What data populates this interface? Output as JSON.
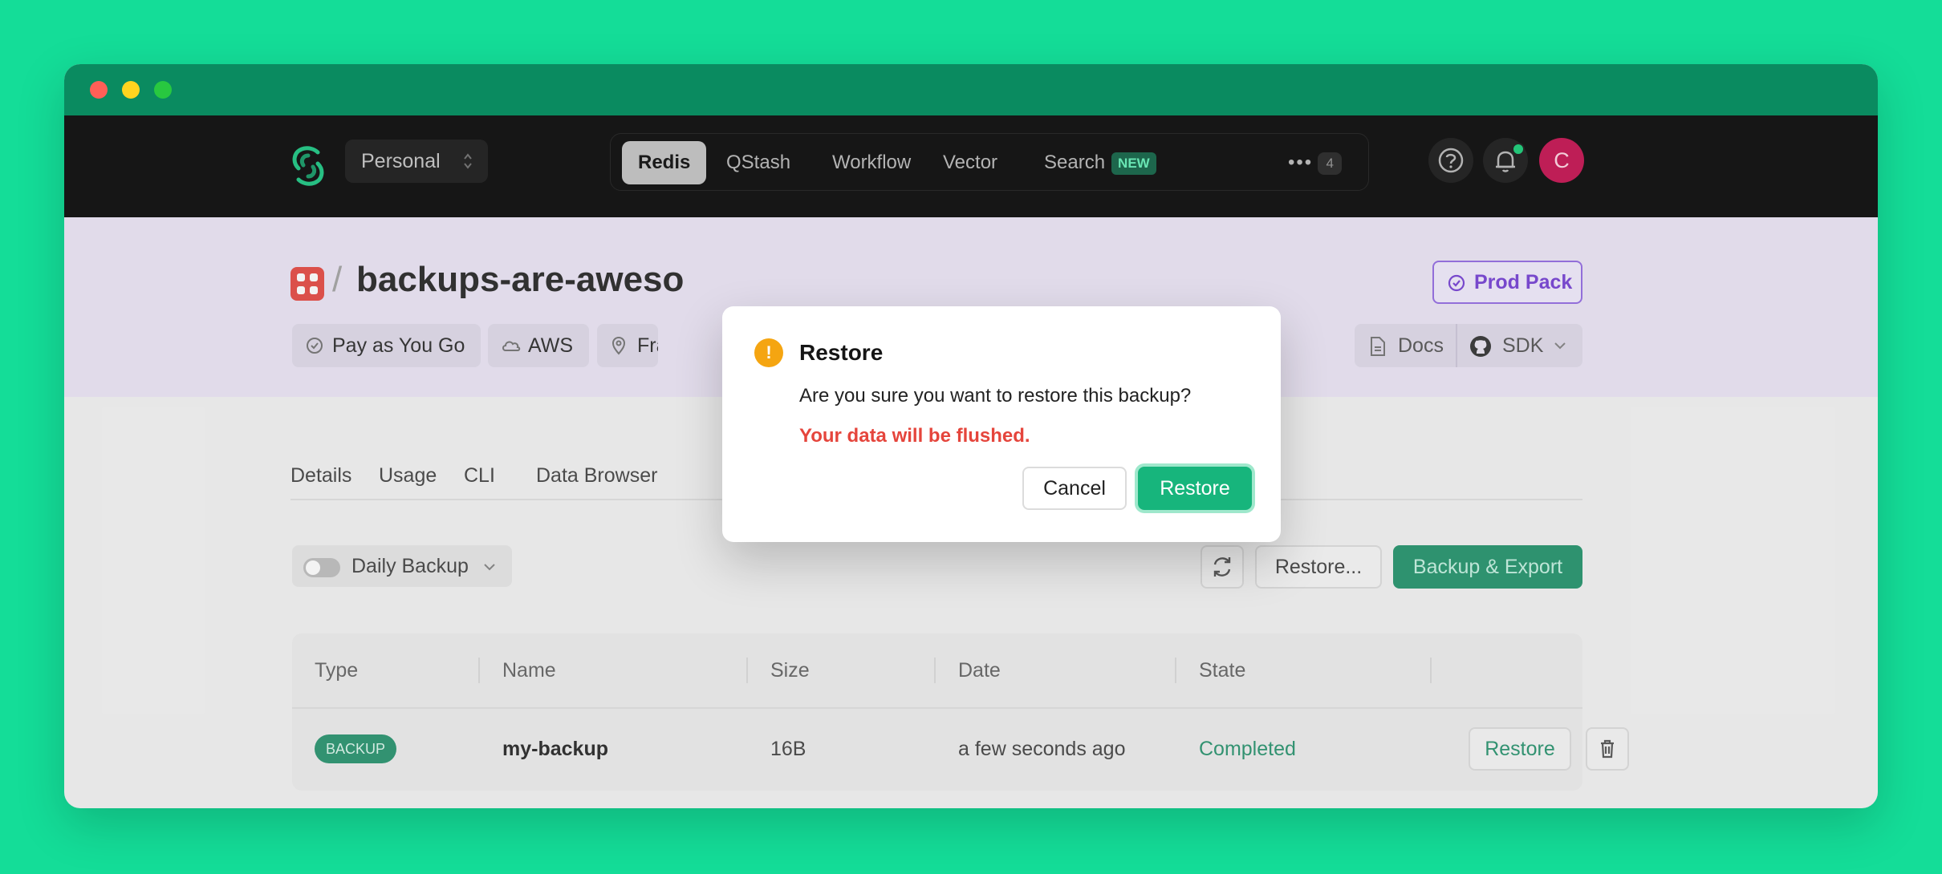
{
  "nav": {
    "team": "Personal",
    "products": [
      "Redis",
      "QStash",
      "Workflow",
      "Vector",
      "Search"
    ],
    "search_badge": "NEW",
    "more_count": "4",
    "avatar_letter": "C"
  },
  "header": {
    "slash": "/",
    "db_name": "backups-are-aweso",
    "chips": [
      "Pay as You Go",
      "AWS",
      "Fra"
    ],
    "prod_pack": "Prod Pack",
    "docs": "Docs",
    "sdk": "SDK"
  },
  "tabs": [
    "Details",
    "Usage",
    "CLI",
    "Data Browser"
  ],
  "toolbar": {
    "daily_backup": "Daily Backup",
    "restore_dots": "Restore...",
    "backup_export": "Backup & Export"
  },
  "table": {
    "headers": [
      "Type",
      "Name",
      "Size",
      "Date",
      "State"
    ],
    "row": {
      "type": "BACKUP",
      "name": "my-backup",
      "size": "16B",
      "date": "a few seconds ago",
      "state": "Completed",
      "action": "Restore"
    }
  },
  "modal": {
    "title": "Restore",
    "message": "Are you sure you want to restore this backup?",
    "warning": "Your data will be flushed.",
    "cancel": "Cancel",
    "confirm": "Restore"
  },
  "colors": {
    "background": "#14dd98",
    "brand": "#17b57c",
    "danger": "#e5453c",
    "warning": "#f5a511"
  }
}
